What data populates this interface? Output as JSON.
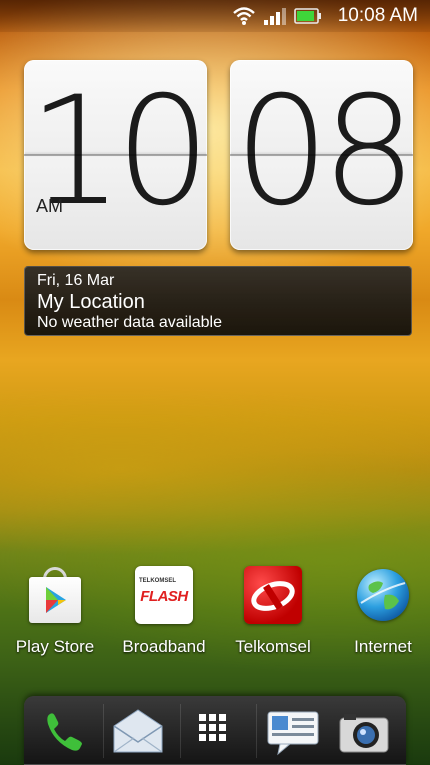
{
  "status_bar": {
    "time": "10:08 AM",
    "icons": [
      "wifi-icon",
      "signal-icon",
      "battery-icon"
    ],
    "battery_level": 0.9
  },
  "clock": {
    "hours": "10",
    "minutes": "08",
    "ampm": "AM"
  },
  "weather": {
    "date": "Fri, 16 Mar",
    "location": "My Location",
    "status": "No weather data available"
  },
  "apps": [
    {
      "label": "Play Store",
      "icon": "play-store-icon"
    },
    {
      "label": "Broadband",
      "icon": "telkomsel-flash-icon"
    },
    {
      "label": "Telkomsel",
      "icon": "telkomsel-icon"
    },
    {
      "label": "Internet",
      "icon": "globe-icon"
    }
  ],
  "flash_icon": {
    "small_text": "TELKOMSEL",
    "big_text": "FLASH"
  },
  "dock": [
    "phone-icon",
    "mail-icon",
    "app-drawer-icon",
    "messages-icon",
    "camera-icon"
  ]
}
